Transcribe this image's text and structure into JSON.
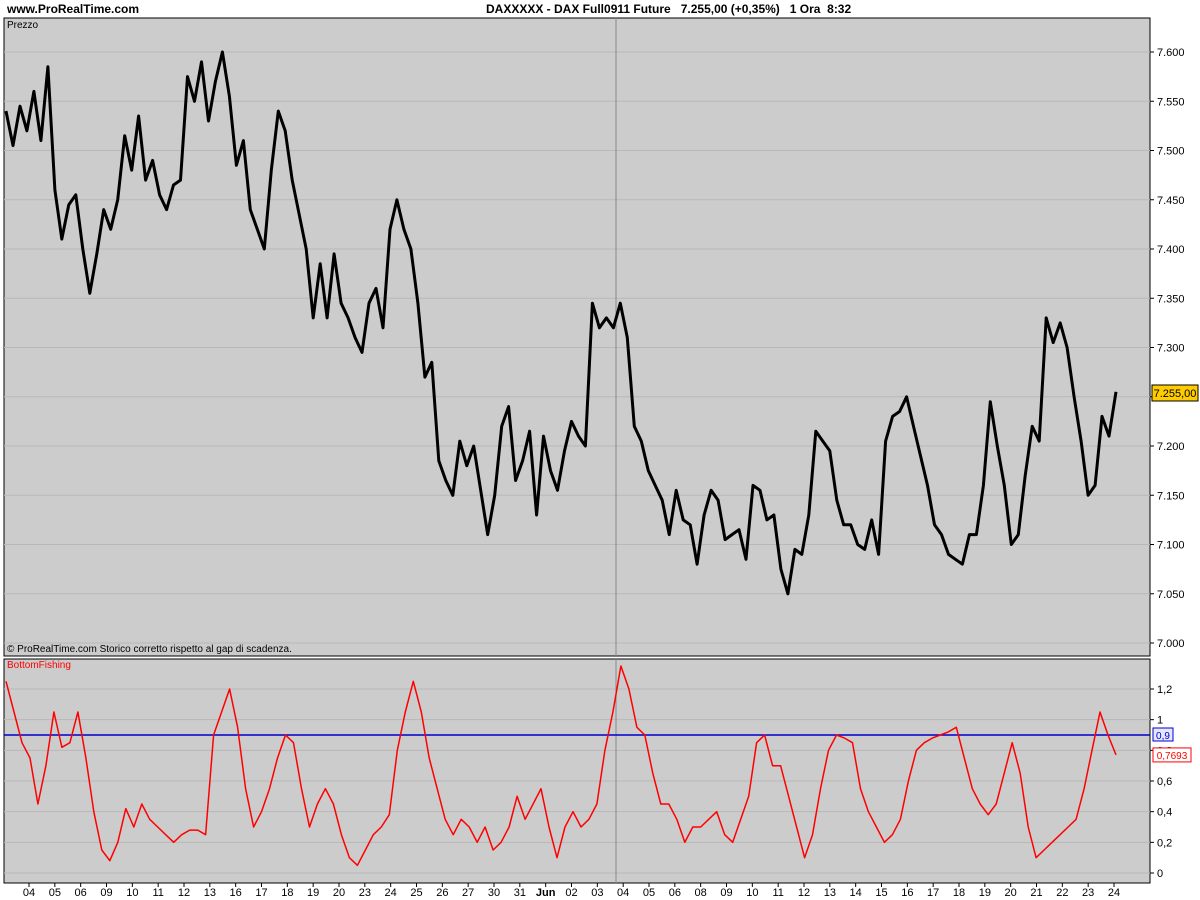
{
  "header": {
    "brand": "www.ProRealTime.com",
    "title": "DAXXXXX - DAX Full0911 Future   7.255,00 (+0,35%)   1 Ora  8:32"
  },
  "price_panel": {
    "label": "Prezzo",
    "copyright": "© ProRealTime.com  Storico corretto rispetto al gap di scadenza.",
    "last_price_label": "7.255,00"
  },
  "indicator_panel": {
    "label": "BottomFishing",
    "level_label": "0,9",
    "last_value_label": "0,7693"
  },
  "colors": {
    "panel_bg": "#cccccc",
    "price_line": "#000000",
    "indicator_line": "#ff0000",
    "level_line": "#0000cc",
    "last_price_bg": "#ffcc00"
  },
  "chart_data": [
    {
      "type": "line",
      "series": [
        {
          "values": [
            7540,
            7505,
            7545,
            7520,
            7560,
            7510,
            7585,
            7460,
            7410,
            7445,
            7455,
            7400,
            7355,
            7395,
            7440,
            7420,
            7450,
            7515,
            7480,
            7535,
            7470,
            7490,
            7455,
            7440,
            7465,
            7470,
            7575,
            7550,
            7590,
            7530,
            7570,
            7600,
            7555,
            7485,
            7510,
            7440,
            7420,
            7400,
            7480,
            7540,
            7520,
            7470,
            7435,
            7400,
            7330,
            7385,
            7330,
            7395,
            7345,
            7330,
            7310,
            7295,
            7345,
            7360,
            7320,
            7420,
            7450,
            7420,
            7400,
            7345,
            7270,
            7285,
            7185,
            7165,
            7150,
            7205,
            7180,
            7200,
            7155,
            7110,
            7150,
            7220,
            7240,
            7165,
            7185,
            7215,
            7130,
            7210,
            7175,
            7155,
            7195,
            7225,
            7210,
            7200,
            7345,
            7320,
            7330,
            7320,
            7345,
            7310,
            7220,
            7205,
            7175,
            7160,
            7145,
            7110,
            7155,
            7125,
            7120,
            7080,
            7130,
            7155,
            7145,
            7105,
            7110,
            7115,
            7085,
            7160,
            7155,
            7125,
            7130,
            7075,
            7050,
            7095,
            7090,
            7130,
            7215,
            7205,
            7195,
            7145,
            7120,
            7120,
            7100,
            7095,
            7125,
            7090,
            7205,
            7230,
            7235,
            7250,
            7220,
            7190,
            7160,
            7120,
            7110,
            7090,
            7085,
            7080,
            7110,
            7110,
            7160,
            7245,
            7200,
            7160,
            7100,
            7110,
            7170,
            7220,
            7205,
            7330,
            7305,
            7325,
            7300,
            7250,
            7205,
            7150,
            7160,
            7230,
            7210,
            7255
          ]
        }
      ],
      "ylim": [
        7000,
        7600
      ],
      "y_ticks": [
        "7.000",
        "7.050",
        "7.100",
        "7.150",
        "7.200",
        "7.250",
        "7.300",
        "7.350",
        "7.400",
        "7.450",
        "7.500",
        "7.550",
        "7.600"
      ],
      "y_tick_values": [
        7000,
        7050,
        7100,
        7150,
        7200,
        7250,
        7300,
        7350,
        7400,
        7450,
        7500,
        7550,
        7600
      ]
    },
    {
      "type": "line",
      "series": [
        {
          "values": [
            1.25,
            1.05,
            0.85,
            0.75,
            0.45,
            0.7,
            1.05,
            0.82,
            0.85,
            1.05,
            0.75,
            0.4,
            0.15,
            0.08,
            0.2,
            0.42,
            0.3,
            0.45,
            0.35,
            0.3,
            0.25,
            0.2,
            0.25,
            0.28,
            0.28,
            0.25,
            0.9,
            1.05,
            1.2,
            0.95,
            0.55,
            0.3,
            0.4,
            0.55,
            0.75,
            0.9,
            0.85,
            0.55,
            0.3,
            0.45,
            0.55,
            0.45,
            0.25,
            0.1,
            0.05,
            0.15,
            0.25,
            0.3,
            0.38,
            0.8,
            1.05,
            1.25,
            1.05,
            0.75,
            0.55,
            0.35,
            0.25,
            0.35,
            0.3,
            0.2,
            0.3,
            0.15,
            0.2,
            0.3,
            0.5,
            0.35,
            0.45,
            0.55,
            0.3,
            0.1,
            0.3,
            0.4,
            0.3,
            0.35,
            0.45,
            0.8,
            1.05,
            1.35,
            1.2,
            0.95,
            0.9,
            0.65,
            0.45,
            0.45,
            0.35,
            0.2,
            0.3,
            0.3,
            0.35,
            0.4,
            0.25,
            0.2,
            0.35,
            0.5,
            0.85,
            0.9,
            0.7,
            0.7,
            0.5,
            0.3,
            0.1,
            0.25,
            0.55,
            0.8,
            0.9,
            0.88,
            0.85,
            0.55,
            0.4,
            0.3,
            0.2,
            0.25,
            0.35,
            0.6,
            0.8,
            0.85,
            0.88,
            0.9,
            0.92,
            0.95,
            0.75,
            0.55,
            0.45,
            0.38,
            0.45,
            0.65,
            0.85,
            0.65,
            0.3,
            0.1,
            0.15,
            0.2,
            0.25,
            0.3,
            0.35,
            0.55,
            0.8,
            1.05,
            0.9,
            0.77
          ]
        },
        {
          "values": [
            0.9,
            0.9
          ]
        }
      ],
      "ylim": [
        0,
        1.35
      ],
      "y_ticks": [
        "0",
        "0,2",
        "0,4",
        "0,6",
        "0,8",
        "1",
        "1,2"
      ],
      "y_tick_values": [
        0,
        0.2,
        0.4,
        0.6,
        0.8,
        1,
        1.2
      ]
    }
  ],
  "x_axis": {
    "ticks": [
      "04",
      "05",
      "06",
      "09",
      "10",
      "11",
      "12",
      "13",
      "16",
      "17",
      "18",
      "19",
      "20",
      "23",
      "24",
      "25",
      "26",
      "27",
      "30",
      "31",
      "Jun",
      "02",
      "03",
      "04",
      "05",
      "06",
      "08",
      "09",
      "10",
      "11",
      "12",
      "13",
      "14",
      "15",
      "16",
      "17",
      "18",
      "19",
      "20",
      "21",
      "22",
      "23",
      "24"
    ],
    "month_label": "Jun"
  }
}
